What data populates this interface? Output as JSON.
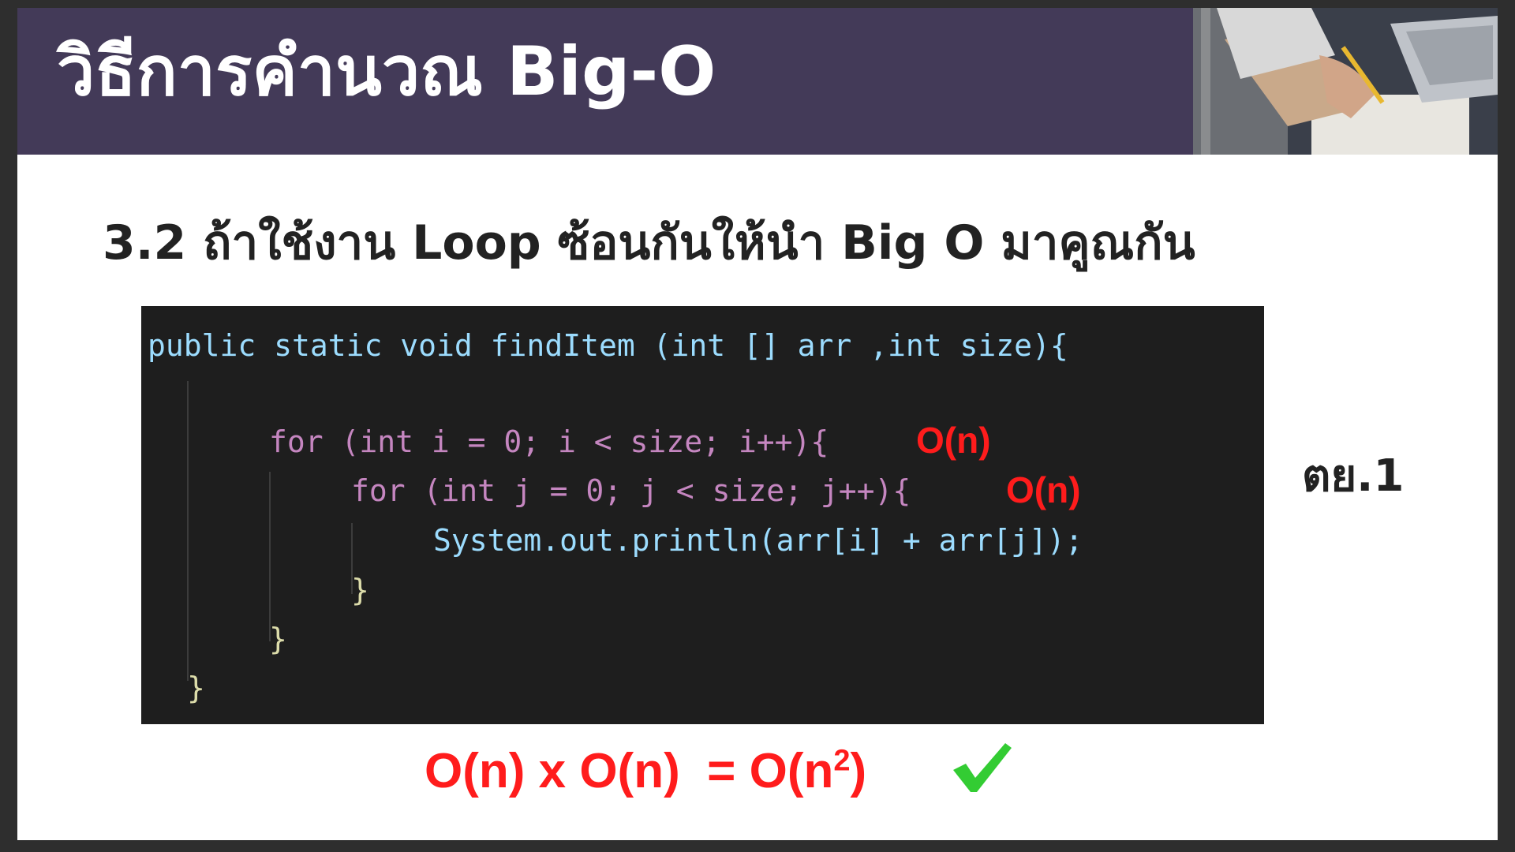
{
  "header": {
    "title": "วิธีการคำนวณ Big-O"
  },
  "subtitle": "3.2 ถ้าใช้งาน Loop ซ้อนกันให้นำ Big O มาคูณกัน",
  "code": {
    "line1": "public static void findItem (int [] arr ,int size){",
    "line2": "for (int i = 0; i < size; i++){",
    "line3": "for (int j = 0; j < size; j++){",
    "line4": "System.out.println(arr[i] + arr[j]);",
    "line5": "}",
    "line6": "}",
    "line7": "}"
  },
  "annotations": {
    "outer_loop": "O(n)",
    "inner_loop": "O(n)"
  },
  "side_label": "ตย.1",
  "formula": {
    "left": "O(n) x O(n)  = O(n",
    "exponent": "2",
    "right": ")"
  },
  "icons": {
    "check": "check-icon",
    "photo": "photo-person-writing"
  },
  "colors": {
    "header_bg": "#433a58",
    "annotation_red": "#ff1c1c",
    "check_green": "#33cc33",
    "code_bg": "#1e1e1e"
  }
}
